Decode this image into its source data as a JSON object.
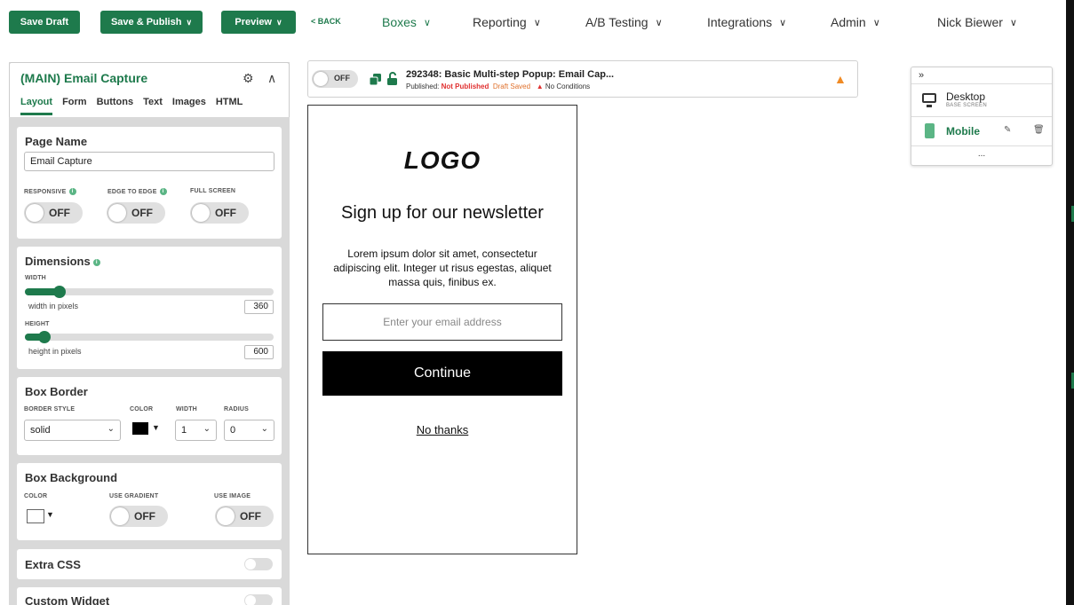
{
  "topbar": {
    "save_draft": "Save Draft",
    "save_publish": "Save & Publish",
    "preview": "Preview",
    "back": "< BACK",
    "nav": [
      {
        "label": "Boxes"
      },
      {
        "label": "Reporting"
      },
      {
        "label": "A/B Testing"
      },
      {
        "label": "Integrations"
      },
      {
        "label": "Admin"
      }
    ],
    "user": "Nick Biewer",
    "chevron": "∨"
  },
  "panel": {
    "title": "(MAIN) Email Capture",
    "tabs": [
      "Layout",
      "Form",
      "Buttons",
      "Text",
      "Images",
      "HTML"
    ],
    "active_tab": "Layout",
    "page_name": {
      "heading": "Page Name",
      "value": "Email Capture",
      "responsive_label": "RESPONSIVE",
      "edge_label": "EDGE TO EDGE",
      "fullscreen_label": "FULL SCREEN",
      "responsive": "OFF",
      "edge": "OFF",
      "fullscreen": "OFF"
    },
    "dimensions": {
      "heading": "Dimensions",
      "width_label": "WIDTH",
      "width_hint": "width in pixels",
      "width_value": "360",
      "width_fraction": 0.14,
      "height_label": "HEIGHT",
      "height_hint": "height in pixels",
      "height_value": "600",
      "height_fraction": 0.08
    },
    "border": {
      "heading": "Box Border",
      "style_label": "BORDER STYLE",
      "color_label": "COLOR",
      "width_label": "WIDTH",
      "radius_label": "RADIUS",
      "style": "solid",
      "color": "#000000",
      "width": "1",
      "radius": "0"
    },
    "background": {
      "heading": "Box Background",
      "color_label": "COLOR",
      "gradient_label": "USE GRADIENT",
      "image_label": "USE IMAGE",
      "color": "#ffffff",
      "gradient": "OFF",
      "image": "OFF"
    },
    "extra_css": "Extra CSS",
    "custom_widget": "Custom Widget"
  },
  "campaign": {
    "toggle": "OFF",
    "title": "292348: Basic Multi-step Popup: Email Cap...",
    "published_label": "Published:",
    "published_status": "Not Published",
    "draft_status": "Draft Saved",
    "conditions": "No Conditions"
  },
  "preview": {
    "logo": "LOGO",
    "headline": "Sign up for our newsletter",
    "body": "Lorem ipsum dolor sit amet, consectetur adipiscing elit. Integer ut risus egestas, aliquet massa quis, finibus ex.",
    "email_placeholder": "Enter your email address",
    "continue": "Continue",
    "no_thanks": "No thanks"
  },
  "screens": {
    "collapse": "»",
    "desktop": "Desktop",
    "desktop_sub": "BASE SCREEN",
    "mobile": "Mobile",
    "more": "..."
  },
  "colors": {
    "accent": "#1e7a4c",
    "alert_red": "#e03030",
    "warning": "#f08a24"
  }
}
